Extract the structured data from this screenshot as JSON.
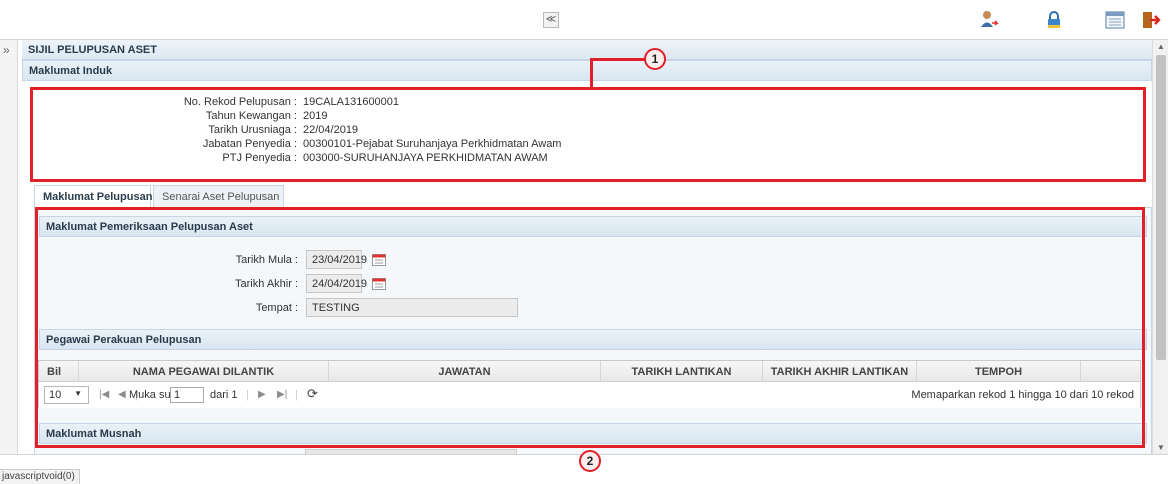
{
  "toolbar": {
    "collapse_glyph": "≪",
    "icons": [
      "user-switch-icon",
      "lock-icon",
      "list-view-icon",
      "logout-icon"
    ]
  },
  "sidebar": {
    "toggle_glyph": "»"
  },
  "page": {
    "title": "SIJIL PELUPUSAN ASET",
    "maklumat_induk": {
      "header": "Maklumat Induk",
      "fields": [
        {
          "label": "No. Rekod Pelupusan :",
          "value": "19CALA131600001"
        },
        {
          "label": "Tahun Kewangan :",
          "value": "2019"
        },
        {
          "label": "Tarikh Urusniaga :",
          "value": "22/04/2019"
        },
        {
          "label": "Jabatan Penyedia :",
          "value": "00300101-Pejabat Suruhanjaya Perkhidmatan Awam"
        },
        {
          "label": "PTJ Penyedia :",
          "value": "003000-SURUHANJAYA PERKHIDMATAN AWAM"
        }
      ]
    },
    "tabs": [
      {
        "label": "Maklumat Pelupusan",
        "active": true
      },
      {
        "label": "Senarai Aset Pelupusan",
        "active": false
      }
    ],
    "pemeriksaan": {
      "header": "Maklumat Pemeriksaan Pelupusan Aset",
      "tarikh_mula_label": "Tarikh Mula :",
      "tarikh_mula_value": "23/04/2019",
      "tarikh_akhir_label": "Tarikh Akhir :",
      "tarikh_akhir_value": "24/04/2019",
      "tempat_label": "Tempat :",
      "tempat_value": "TESTING"
    },
    "perakuan": {
      "header": "Pegawai Perakuan Pelupusan",
      "columns": [
        "Bil",
        "NAMA PEGAWAI DILANTIK",
        "JAWATAN",
        "TARIKH LANTIKAN",
        "TARIKH AKHIR LANTIKAN",
        "TEMPOH"
      ],
      "pager": {
        "page_size": "10",
        "page_label": "Muka surat",
        "page_value": "1",
        "of_label": "dari 1",
        "summary": "Memaparkan rekod 1 hingga 10 dari 10 rekod"
      }
    },
    "musnah": {
      "header": "Maklumat Musnah"
    }
  },
  "status_bar": {
    "text": "javascriptvoid(0)"
  },
  "annotations": {
    "callout_1": "1",
    "callout_2": "2",
    "color": "#e1202a"
  }
}
